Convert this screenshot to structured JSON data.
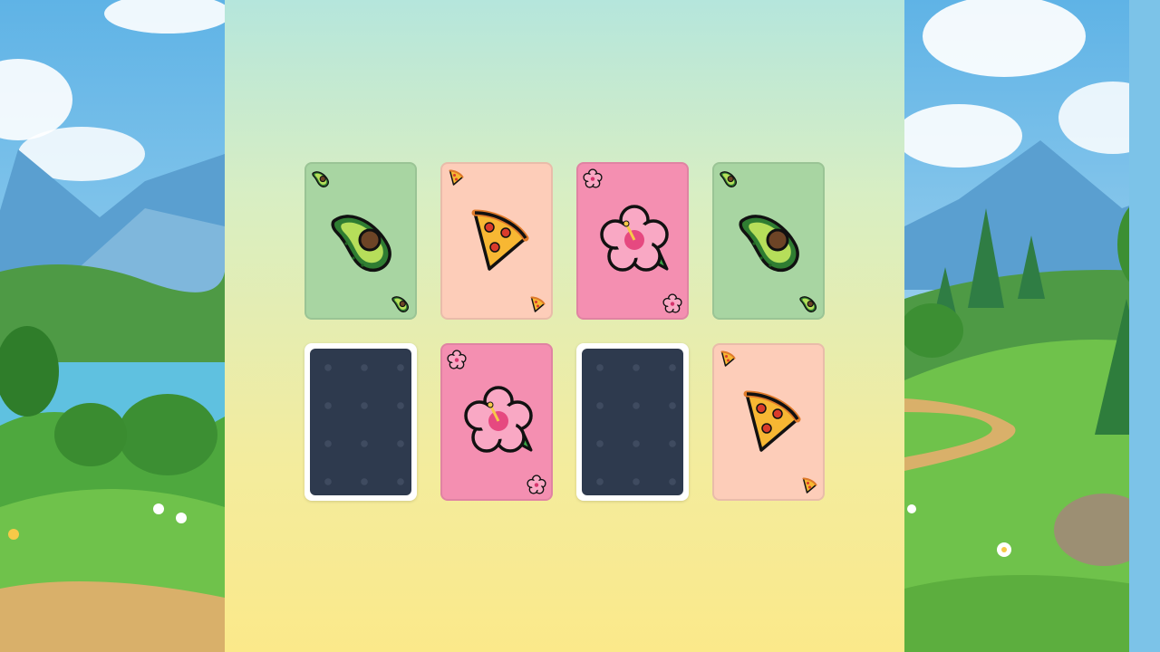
{
  "game": {
    "cards": [
      {
        "state": "face-up",
        "symbol": "avocado-icon",
        "color": "#a8d5a2"
      },
      {
        "state": "face-up",
        "symbol": "pizza-icon",
        "color": "#fdcdb9"
      },
      {
        "state": "face-up",
        "symbol": "hibiscus-icon",
        "color": "#f48fb1"
      },
      {
        "state": "face-up",
        "symbol": "avocado-icon",
        "color": "#a8d5a2"
      },
      {
        "state": "face-down",
        "symbol": "card-back",
        "color": "#2e3a4e"
      },
      {
        "state": "face-up",
        "symbol": "hibiscus-icon",
        "color": "#f48fb1"
      },
      {
        "state": "face-down",
        "symbol": "card-back",
        "color": "#2e3a4e"
      },
      {
        "state": "face-up",
        "symbol": "pizza-icon",
        "color": "#fdcdb9"
      }
    ]
  },
  "theme": {
    "card_back": "#2e3a4e",
    "board_top": "#b5e6dc",
    "board_bottom": "#fbe98a"
  }
}
